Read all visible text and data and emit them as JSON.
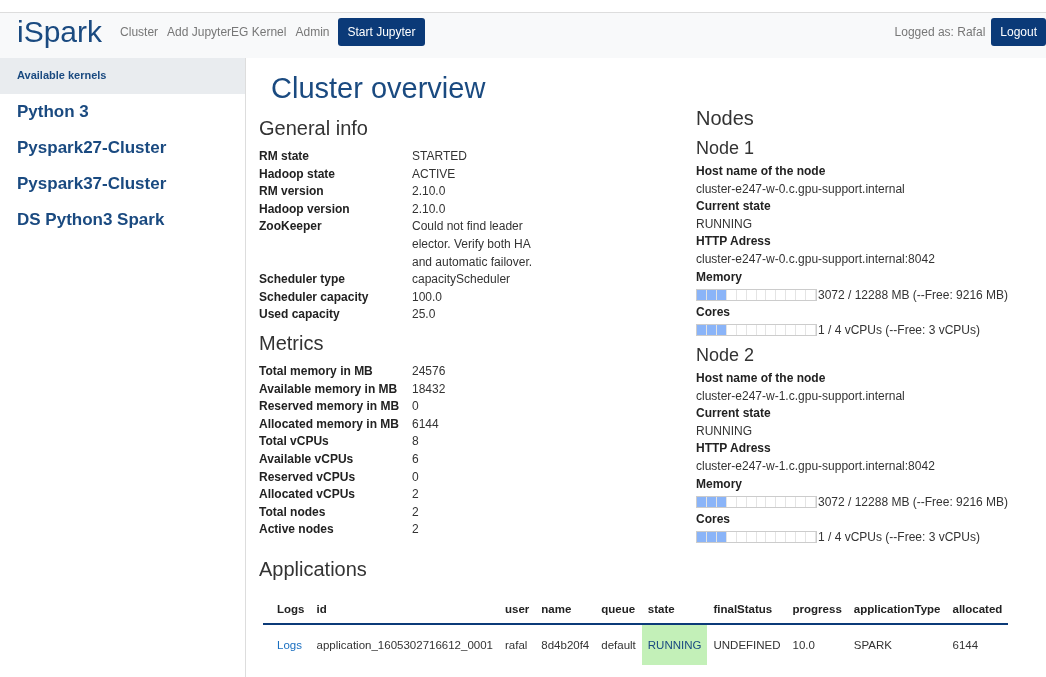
{
  "navbar": {
    "brand": "iSpark",
    "links": [
      "Cluster",
      "Add JupyterEG Kernel",
      "Admin"
    ],
    "primary_button": "Start Jupyter",
    "user_label": "Logged as: Rafal",
    "logout_button": "Logout"
  },
  "sidebar": {
    "header": "Available kernels",
    "items": [
      "Python 3",
      "Pyspark27-Cluster",
      "Pyspark37-Cluster",
      "DS Python3 Spark"
    ]
  },
  "page_title": "Cluster overview",
  "general_info": {
    "title": "General info",
    "rows": [
      {
        "label": "RM state",
        "value": "STARTED"
      },
      {
        "label": "Hadoop state",
        "value": "ACTIVE"
      },
      {
        "label": "RM version",
        "value": "2.10.0"
      },
      {
        "label": "Hadoop version",
        "value": "2.10.0"
      },
      {
        "label": "ZooKeeper",
        "value": "Could not find leader elector. Verify both HA and automatic failover."
      },
      {
        "label": "Scheduler type",
        "value": "capacityScheduler"
      },
      {
        "label": "Scheduler capacity",
        "value": "100.0"
      },
      {
        "label": "Used capacity",
        "value": "25.0"
      }
    ]
  },
  "metrics": {
    "title": "Metrics",
    "rows": [
      {
        "label": "Total memory in MB",
        "value": "24576"
      },
      {
        "label": "Available memory in MB",
        "value": "18432"
      },
      {
        "label": "Reserved memory in MB",
        "value": "0"
      },
      {
        "label": "Allocated memory in MB",
        "value": "6144"
      },
      {
        "label": "Total vCPUs",
        "value": "8"
      },
      {
        "label": "Available vCPUs",
        "value": "6"
      },
      {
        "label": "Reserved vCPUs",
        "value": "0"
      },
      {
        "label": "Allocated vCPUs",
        "value": "2"
      },
      {
        "label": "Total nodes",
        "value": "2"
      },
      {
        "label": "Active nodes",
        "value": "2"
      }
    ]
  },
  "nodes": {
    "title": "Nodes",
    "items": [
      {
        "title": "Node 1",
        "host_label": "Host name of the node",
        "host": "cluster-e247-w-0.c.gpu-support.internal",
        "state_label": "Current state",
        "state": "RUNNING",
        "http_label": "HTTP Adress",
        "http": "cluster-e247-w-0.c.gpu-support.internal:8042",
        "memory_label": "Memory",
        "memory": {
          "level": 0.25,
          "reading": "3072 / 12288 MB (--Free: 9216 MB)"
        },
        "cores_label": "Cores",
        "cores": {
          "level": 0.25,
          "reading": "1 / 4 vCPUs (--Free: 3 vCPUs)"
        }
      },
      {
        "title": "Node 2",
        "host_label": "Host name of the node",
        "host": "cluster-e247-w-1.c.gpu-support.internal",
        "state_label": "Current state",
        "state": "RUNNING",
        "http_label": "HTTP Adress",
        "http": "cluster-e247-w-1.c.gpu-support.internal:8042",
        "memory_label": "Memory",
        "memory": {
          "level": 0.25,
          "reading": "3072 / 12288 MB (--Free: 9216 MB)"
        },
        "cores_label": "Cores",
        "cores": {
          "level": 0.25,
          "reading": "1 / 4 vCPUs (--Free: 3 vCPUs)"
        }
      }
    ]
  },
  "applications": {
    "title": "Applications",
    "columns": [
      "Logs",
      "id",
      "user",
      "name",
      "queue",
      "state",
      "finalStatus",
      "progress",
      "applicationType",
      "allocated"
    ],
    "rows": [
      {
        "logs": "Logs",
        "id": "application_1605302716612_0001",
        "user": "rafal",
        "name": "8d4b20f4",
        "queue": "default",
        "state": "RUNNING",
        "color": "#c3f0b8",
        "final_status": "UNDEFINED",
        "progress": "10.0",
        "application_type": "SPARK",
        "allocated": "6144"
      }
    ]
  }
}
